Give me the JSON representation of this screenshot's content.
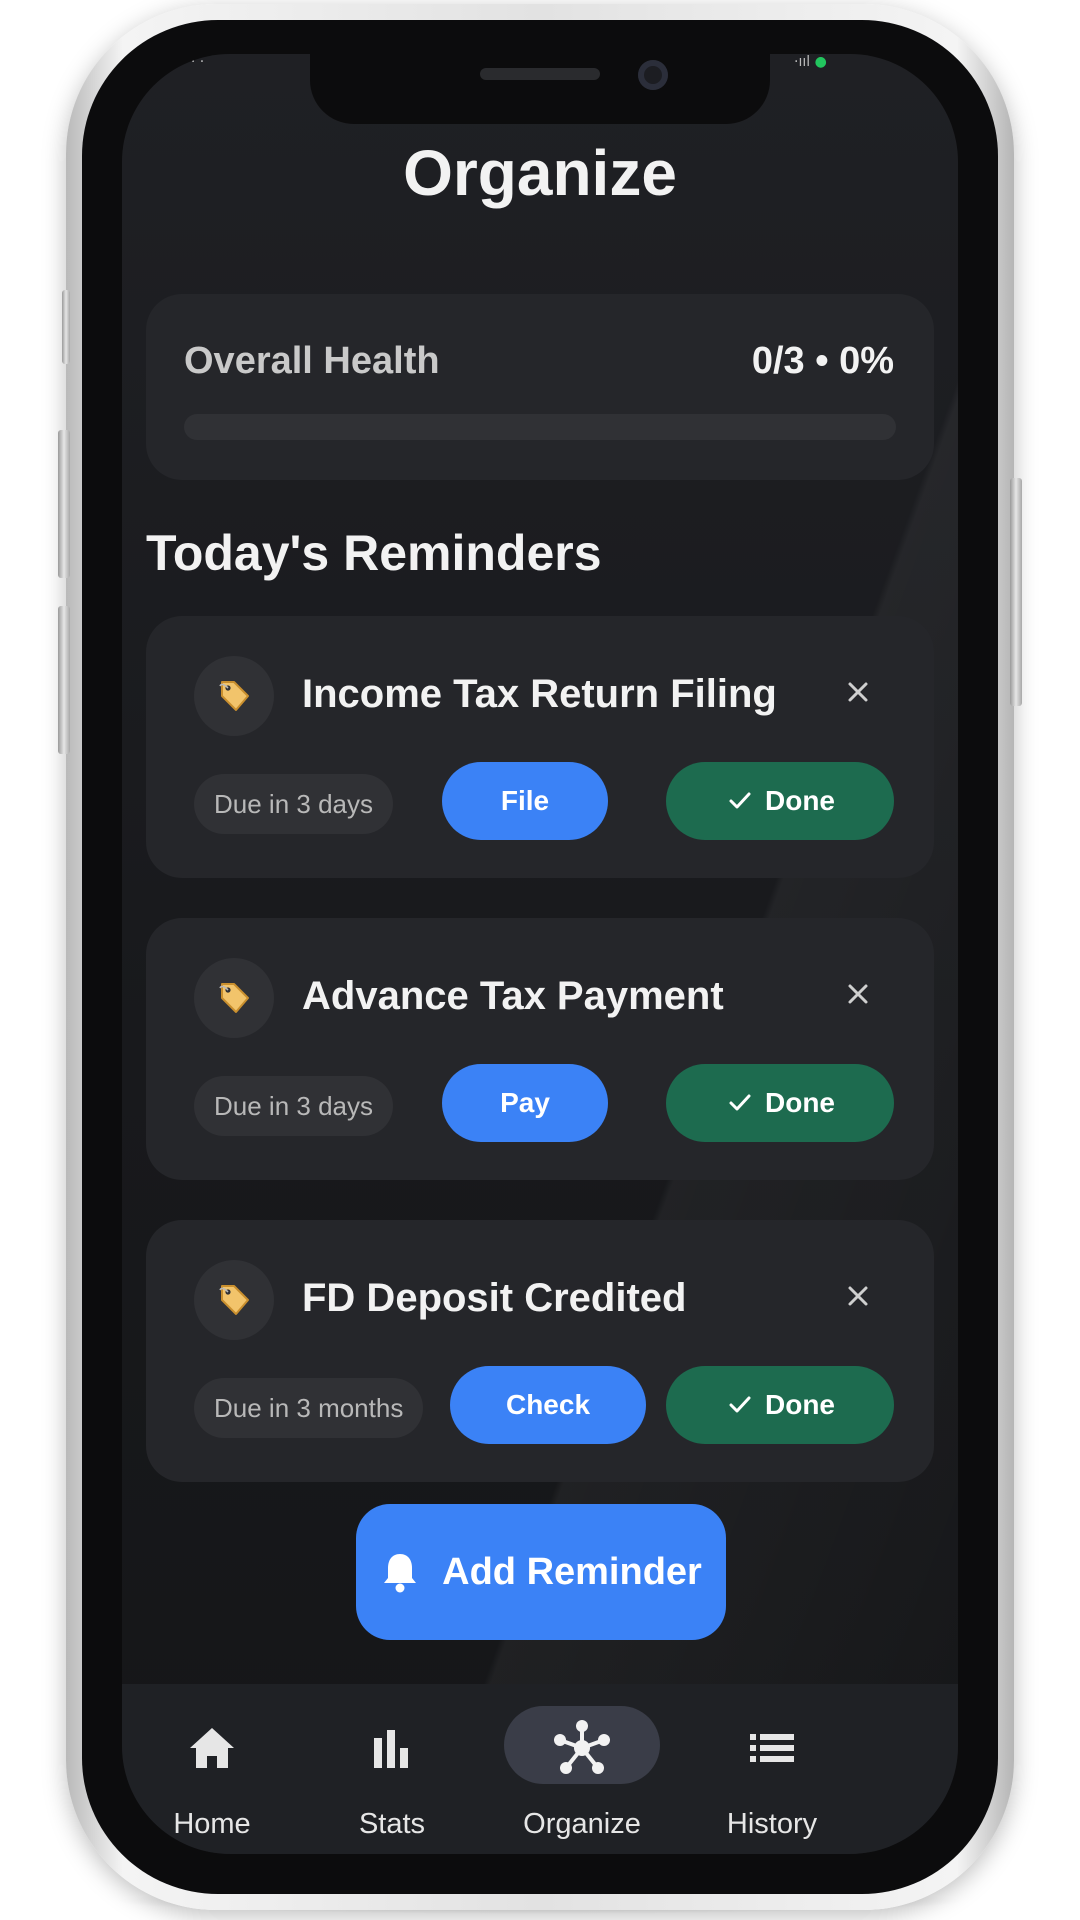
{
  "header": {
    "title": "Organize"
  },
  "health": {
    "label": "Overall Health",
    "value": "0/3 • 0%",
    "progress": 0
  },
  "section": {
    "title": "Today's Reminders"
  },
  "reminders": [
    {
      "title": "Income Tax Return Filing",
      "due": "Due in 3 days",
      "action": "File",
      "done": "Done",
      "icon": "tag-icon"
    },
    {
      "title": "Advance Tax Payment",
      "due": "Due in 3 days",
      "action": "Pay",
      "done": "Done",
      "icon": "tag-icon"
    },
    {
      "title": "FD Deposit Credited",
      "due": "Due in 3 months",
      "action": "Check",
      "done": "Done",
      "icon": "tag-icon"
    }
  ],
  "add_button": {
    "label": "Add Reminder",
    "icon": "bell-icon"
  },
  "nav": {
    "items": [
      {
        "label": "Home",
        "icon": "home-icon",
        "active": false
      },
      {
        "label": "Stats",
        "icon": "bar-chart-icon",
        "active": false
      },
      {
        "label": "Organize",
        "icon": "network-icon",
        "active": true
      },
      {
        "label": "History",
        "icon": "list-icon",
        "active": false
      }
    ]
  },
  "colors": {
    "accent": "#3b82f6",
    "done": "#1d6b4f",
    "background": "#1b1c1f",
    "card": "#25262a"
  }
}
